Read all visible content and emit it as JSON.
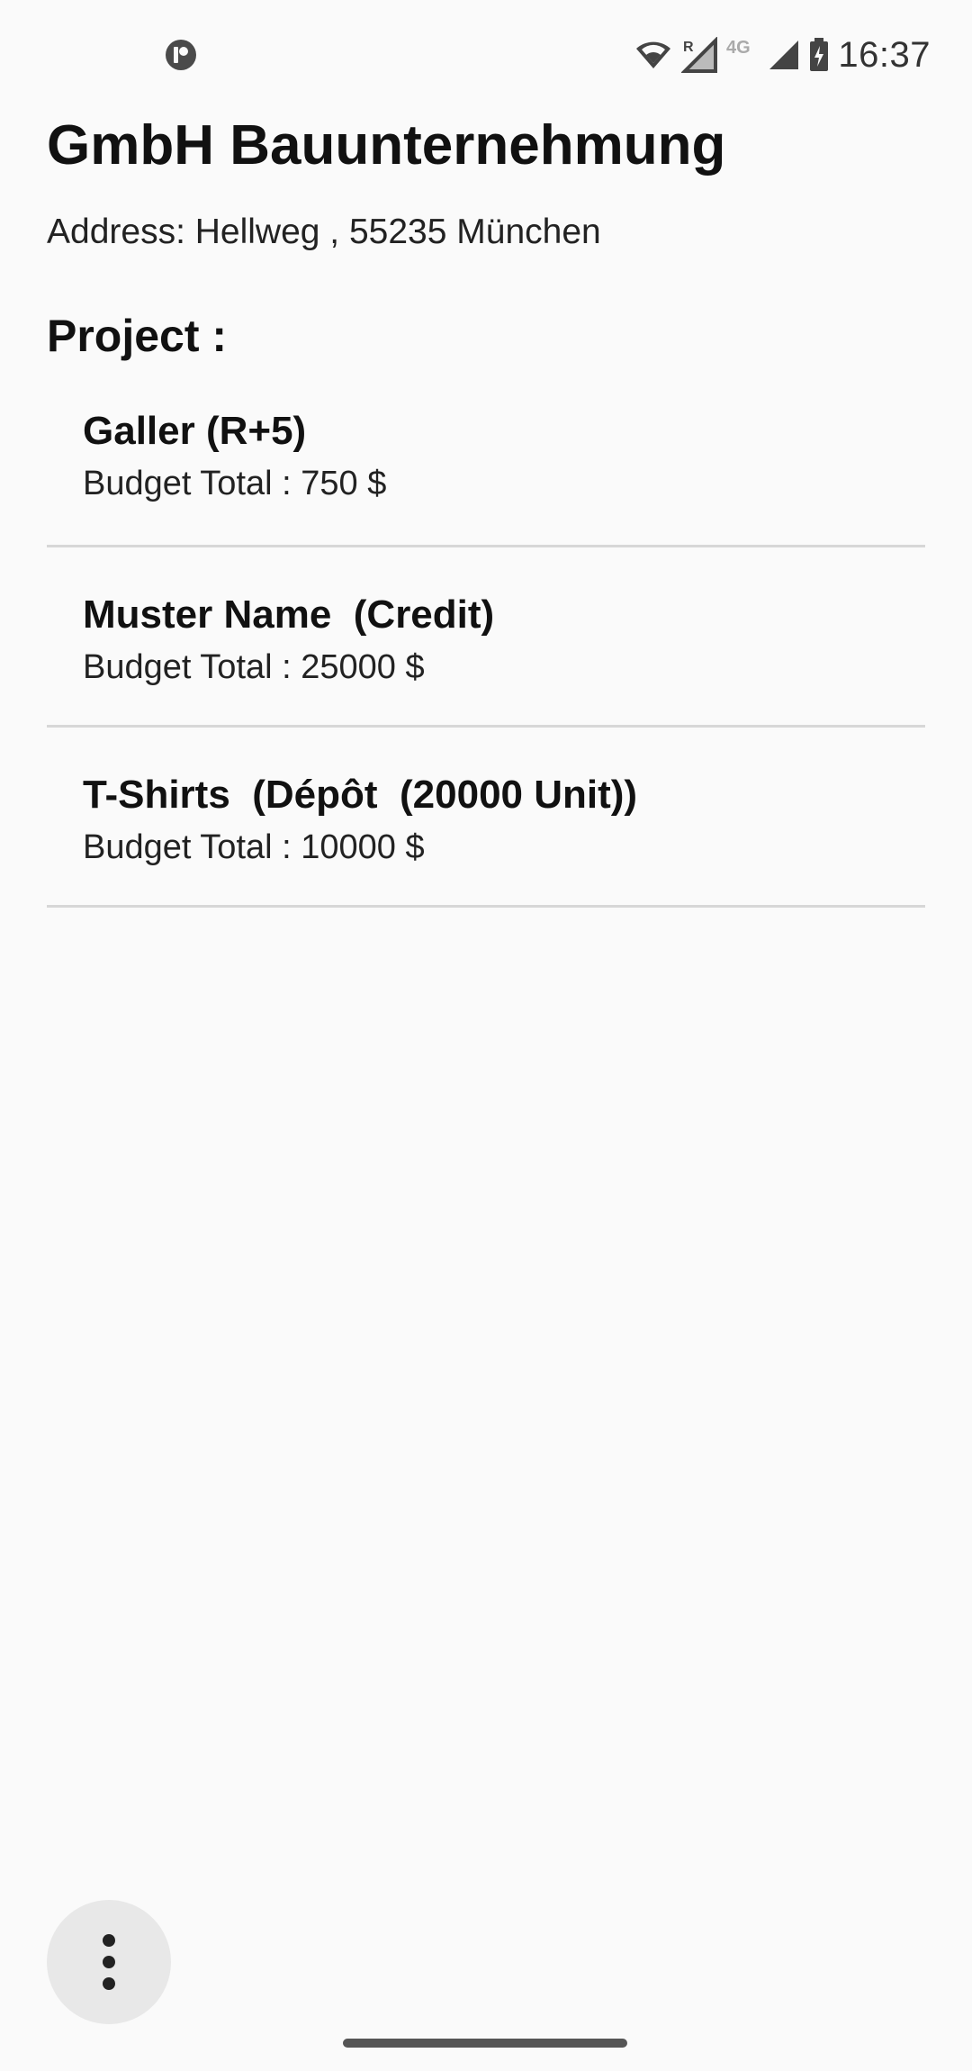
{
  "status_bar": {
    "time": "16:37",
    "roaming_label": "R",
    "network_label": "4G",
    "icons": [
      "app-notification-icon",
      "wifi-icon",
      "roaming-signal-icon",
      "signal-icon",
      "battery-charging-icon"
    ]
  },
  "company": {
    "name": "GmbH Bauunternehmung",
    "address": "Address: Hellweg , 55235 München"
  },
  "section": {
    "title": "Project :"
  },
  "projects": [
    {
      "title": "Galler (R+5)",
      "budget": "Budget Total : 750 $"
    },
    {
      "title": "Muster Name  (Credit)",
      "budget": "Budget Total : 25000 $"
    },
    {
      "title": "T-Shirts  (Dépôt  (20000 Unit))",
      "budget": "Budget Total : 10000 $"
    }
  ],
  "fab": {
    "icon": "more-vert-icon"
  }
}
